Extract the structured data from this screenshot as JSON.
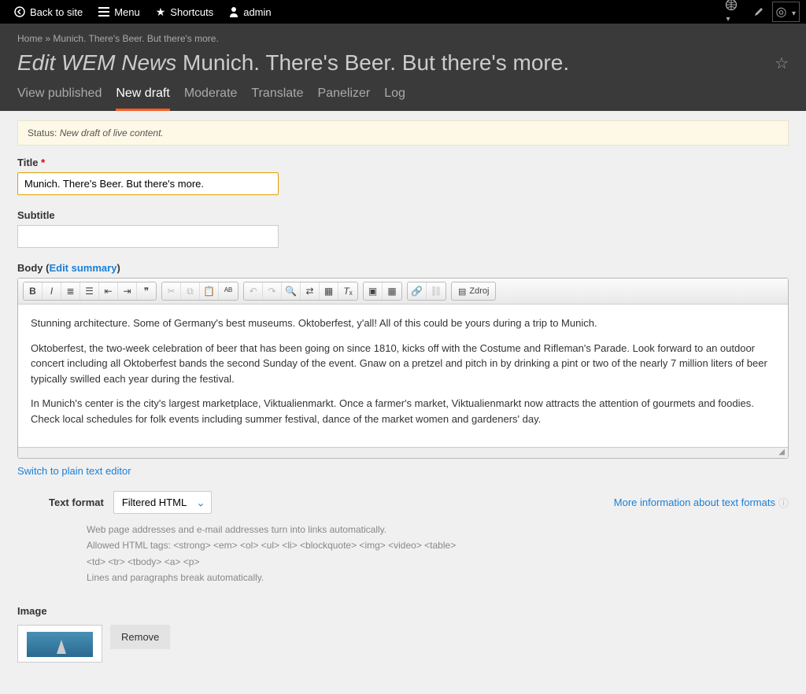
{
  "topbar": {
    "back": "Back to site",
    "menu": "Menu",
    "shortcuts": "Shortcuts",
    "user": "admin"
  },
  "breadcrumb": "Home » Munich. There's Beer. But there's more.",
  "page_title_prefix": "Edit WEM News",
  "page_title_main": "Munich. There's Beer. But there's more.",
  "tabs": {
    "view_published": "View published",
    "new_draft": "New draft",
    "moderate": "Moderate",
    "translate": "Translate",
    "panelizer": "Panelizer",
    "log": "Log"
  },
  "status": {
    "label": "Status: ",
    "value": "New draft of live content."
  },
  "fields": {
    "title_label": "Title",
    "title_value": "Munich. There's Beer. But there's more.",
    "subtitle_label": "Subtitle",
    "subtitle_value": "",
    "body_label": "Body (",
    "body_summary_link": "Edit summary",
    "body_label_close": ")"
  },
  "editor": {
    "source_btn": "Zdroj",
    "paragraphs": {
      "p1": "Stunning architecture. Some of Germany's best museums. Oktoberfest, y'all! All of this could be yours during a trip to Munich.",
      "p2": "Oktoberfest, the two-week celebration of beer that has been going on since 1810, kicks off with the Costume and Rifleman's Parade. Look forward to an outdoor concert including all Oktoberfest bands the second Sunday of the event. Gnaw on a pretzel and pitch in by drinking a pint or two of the nearly 7 million liters of beer typically swilled each year during the festival.",
      "p3": "In Munich's center is the city's largest marketplace, Viktualienmarkt. Once a farmer's market, Viktualienmarkt now attracts the attention of gourmets and foodies. Check local schedules for folk events including summer festival, dance of the market women and gardeners' day."
    }
  },
  "plain_text_link": "Switch to plain text editor",
  "format": {
    "label": "Text format",
    "selected": "Filtered HTML",
    "more_info": "More information about text formats",
    "help1": "Web page addresses and e-mail addresses turn into links automatically.",
    "help2": "Allowed HTML tags: <strong> <em> <ol> <ul> <li> <blockquote> <img> <video> <table> <td> <tr> <tbody> <a> <p>",
    "help3": "Lines and paragraphs break automatically."
  },
  "image": {
    "label": "Image",
    "remove": "Remove"
  }
}
